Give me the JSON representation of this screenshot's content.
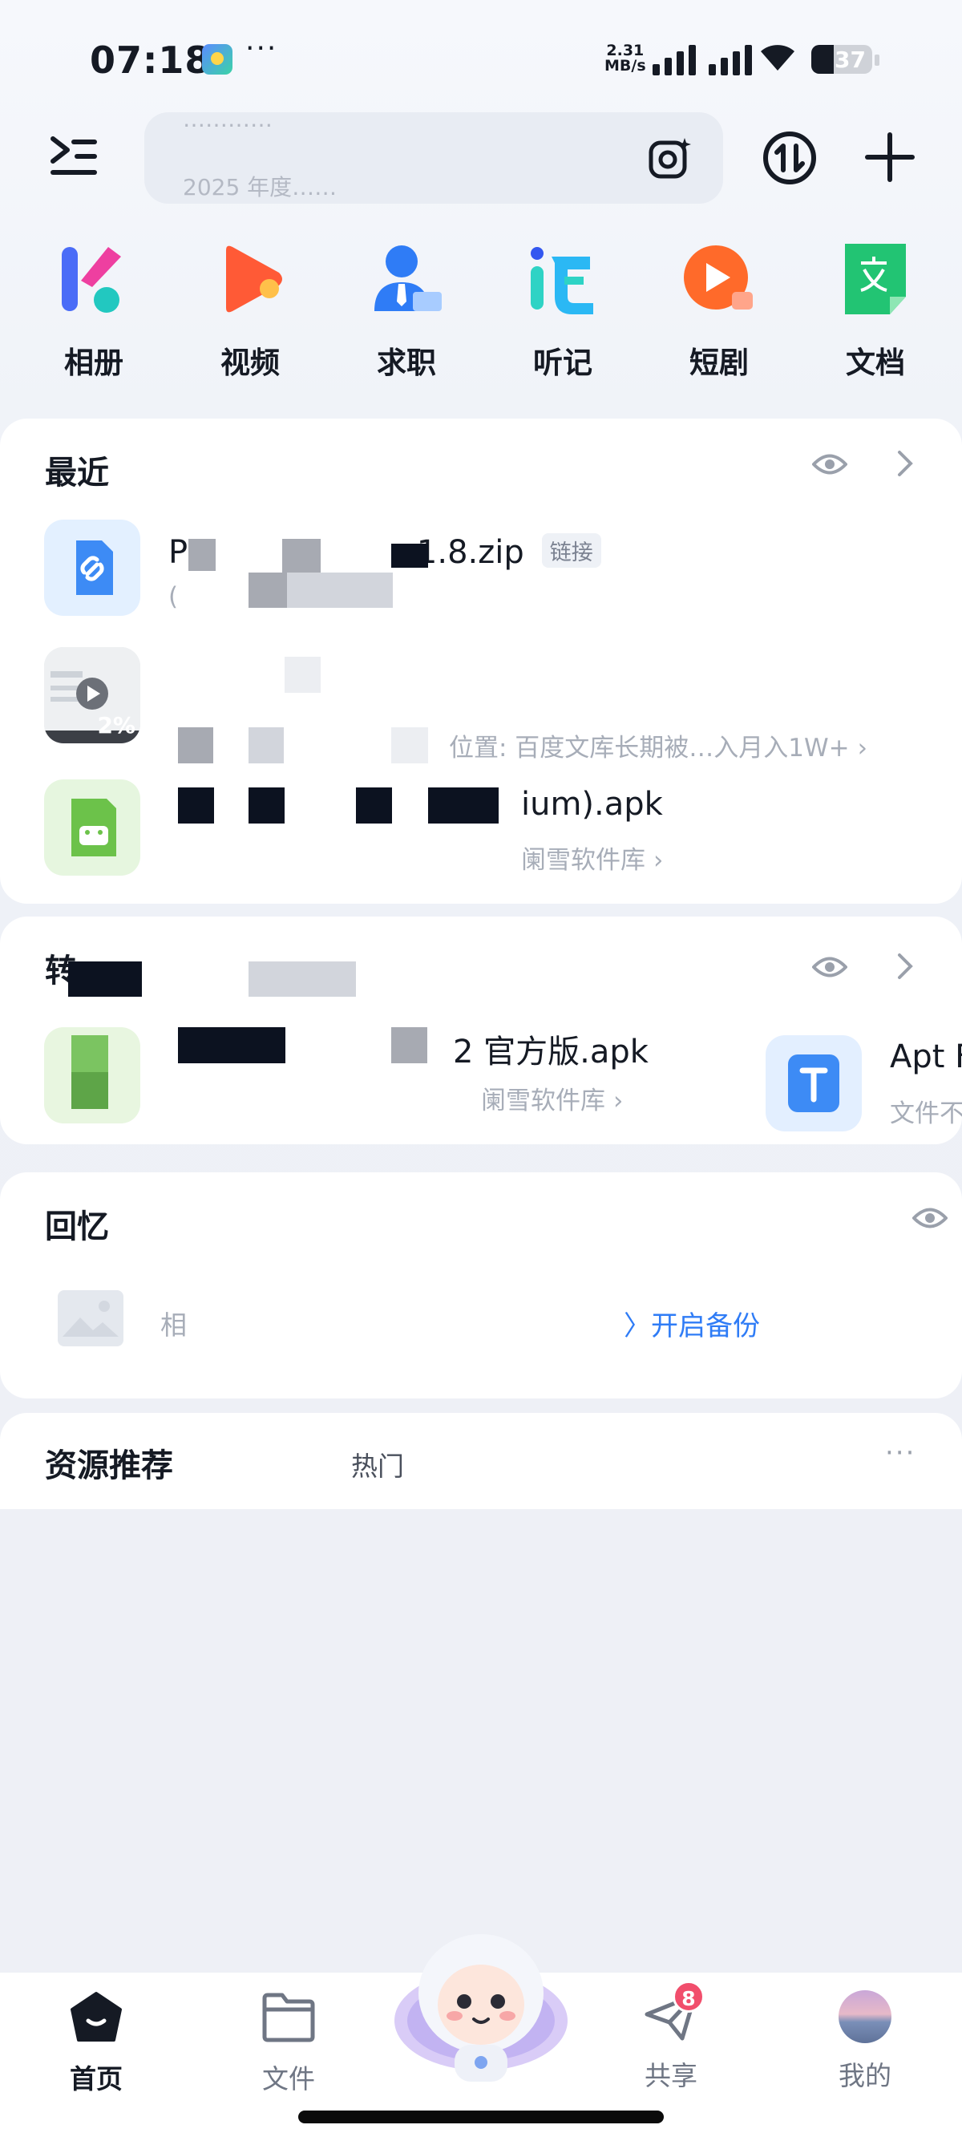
{
  "status_bar": {
    "time": "07:18",
    "more": "···",
    "net_speed_value": "2.31",
    "net_speed_unit": "MB/s",
    "battery": "37"
  },
  "header": {
    "search_hint_top": "…………",
    "search_hint": "2025 年度……"
  },
  "quick_apps": [
    {
      "label": "相册",
      "icon": "album-icon"
    },
    {
      "label": "视频",
      "icon": "video-icon"
    },
    {
      "label": "求职",
      "icon": "job-icon"
    },
    {
      "label": "听记",
      "icon": "transcribe-icon"
    },
    {
      "label": "短剧",
      "icon": "short-drama-icon"
    },
    {
      "label": "文档",
      "icon": "document-icon"
    }
  ],
  "recent": {
    "title": "最近",
    "files": [
      {
        "name_start": "PD",
        "name_end": "1.8.zip",
        "tag": "链接",
        "sub": "(",
        "icon": "link-file-icon"
      },
      {
        "name_start": "",
        "name_end": "",
        "tag": "",
        "sub": "位置: 百度文库长期被…入月入1W+",
        "thumb_label": "2%",
        "icon": "video-thumbnail"
      },
      {
        "name_start": "",
        "name_end": "ium).apk",
        "tag": "",
        "sub": "阑雪软件库",
        "icon": "android-apk-icon"
      }
    ]
  },
  "transfer": {
    "title": "转",
    "files": [
      {
        "name_end": "2 官方版.apk",
        "sub": "阑雪软件库"
      },
      {
        "name_end": "Apt F",
        "sub": "文件不"
      }
    ]
  },
  "memory": {
    "title": "回忆",
    "text": "相",
    "backup_label": "开启备份"
  },
  "resources": {
    "title": "资源推荐",
    "tab": "热门",
    "more": "···"
  },
  "bottom_nav": [
    {
      "label": "首页",
      "icon": "home-icon",
      "active": true
    },
    {
      "label": "文件",
      "icon": "folder-icon",
      "active": false
    },
    {
      "label": "共享",
      "icon": "share-plane-icon",
      "active": false,
      "badge": "8"
    },
    {
      "label": "我的",
      "icon": "avatar",
      "active": false
    }
  ],
  "colors": {
    "accent_blue": "#2f7cf6",
    "badge_red": "#f14e6c"
  }
}
